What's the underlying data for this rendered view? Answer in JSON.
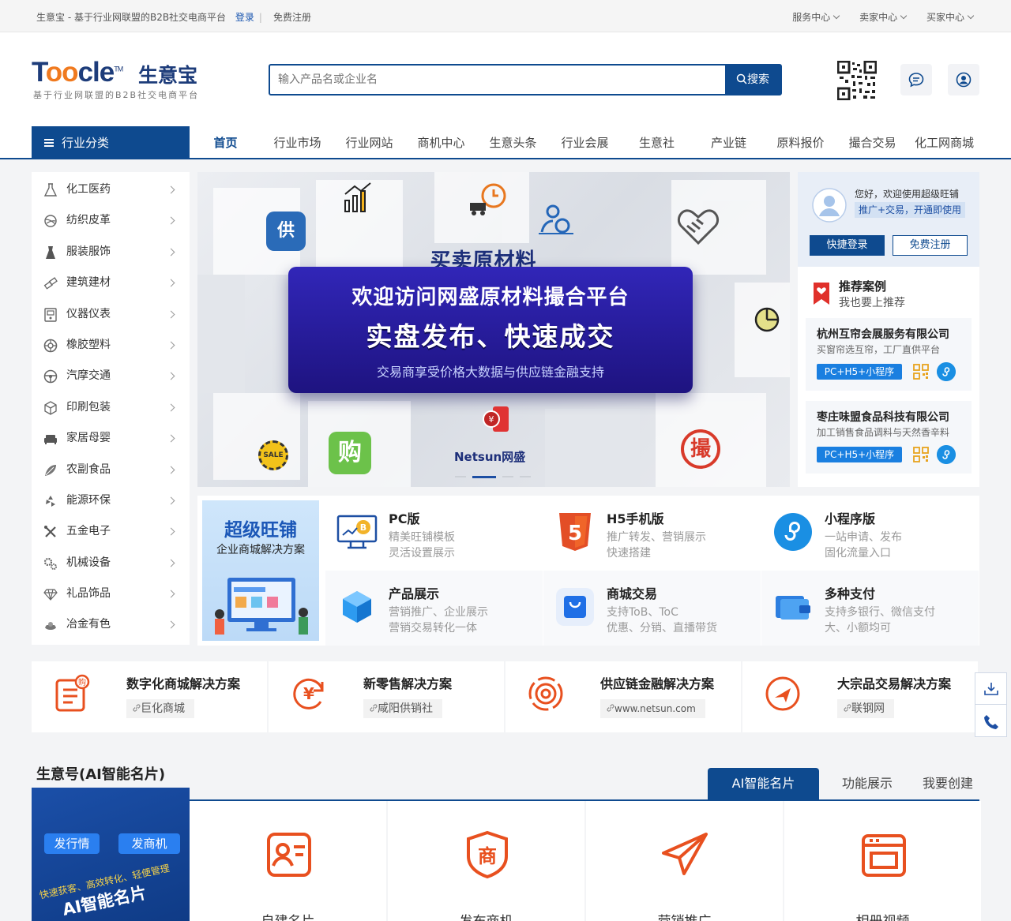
{
  "topbar": {
    "site_desc": "生意宝 - 基于行业网联盟的B2B社交电商平台",
    "login": "登录",
    "register": "免费注册",
    "links": [
      "服务中心",
      "卖家中心",
      "买家中心"
    ]
  },
  "logo": {
    "brand": "Toocle",
    "cn": "生意宝",
    "tagline": "基于行业网联盟的B2B社交电商平台"
  },
  "search": {
    "placeholder": "输入产品名或企业名",
    "button": "搜索"
  },
  "nav": {
    "category_label": "行业分类",
    "items": [
      "首页",
      "行业市场",
      "行业网站",
      "商机中心",
      "生意头条",
      "行业会展",
      "生意社",
      "产业链",
      "原料报价",
      "撮合交易",
      "化工网商城"
    ]
  },
  "categories": [
    "化工医药",
    "纺织皮革",
    "服装服饰",
    "建筑建材",
    "仪器仪表",
    "橡胶塑料",
    "汽摩交通",
    "印刷包装",
    "家居母婴",
    "农副食品",
    "能源环保",
    "五金电子",
    "机械设备",
    "礼品饰品",
    "冶金有色"
  ],
  "banner": {
    "top": "买卖原材料",
    "line1": "欢迎访问网盛原材料撮合平台",
    "line2": "实盘发布、快速成交",
    "line3": "交易商享受价格大数据与供应链金融支持",
    "badge_gong": "供",
    "badge_gou": "购",
    "badge_cuo": "撮",
    "netsun": "Netsun网盛",
    "sale": "SALE"
  },
  "welcome": {
    "greet": "您好，欢迎使用超级旺铺",
    "sub": "推广+交易，开通即使用",
    "login": "快捷登录",
    "register": "免费注册"
  },
  "recommend": {
    "title": "推荐案例",
    "sub": "我也要上推荐",
    "cases": [
      {
        "name": "杭州互帘会展服务有限公司",
        "desc": "买窗帘选互帘，工厂直供平台",
        "tag": "PC+H5+小程序"
      },
      {
        "name": "枣庄味盟食品科技有限公司",
        "desc": "加工销售食品调料与天然香辛料",
        "tag": "PC+H5+小程序"
      }
    ]
  },
  "wangpu": {
    "promo_title": "超级旺铺",
    "promo_sub": "企业商城解决方案",
    "features": [
      {
        "title": "PC版",
        "d1": "精美旺铺模板",
        "d2": "灵活设置展示"
      },
      {
        "title": "H5手机版",
        "d1": "推广转发、营销展示",
        "d2": "快速搭建"
      },
      {
        "title": "小程序版",
        "d1": "一站申请、发布",
        "d2": "固化流量入口"
      },
      {
        "title": "产品展示",
        "d1": "营销推广、企业展示",
        "d2": "营销交易转化一体"
      },
      {
        "title": "商城交易",
        "d1": "支持ToB、ToC",
        "d2": "优惠、分销、直播带货"
      },
      {
        "title": "多种支付",
        "d1": "支持多银行、微信支付",
        "d2": "大、小额均可"
      }
    ]
  },
  "solutions": [
    {
      "title": "数字化商城解决方案",
      "link": "巨化商城"
    },
    {
      "title": "新零售解决方案",
      "link": "咸阳供销社"
    },
    {
      "title": "供应链金融解决方案",
      "link": "www.netsun.com"
    },
    {
      "title": "大宗品交易解决方案",
      "link": "联钢网"
    }
  ],
  "shengyi": {
    "title": "生意号(AI智能名片)",
    "tabs": [
      "AI智能名片",
      "功能展示",
      "我要创建"
    ],
    "ai_tag1": "发行情",
    "ai_tag2": "发商机",
    "ai_slogan": "快速获客、高效转化、轻便管理",
    "ai_big": "AI智能名片",
    "cards": [
      "自建名片",
      "发布商机",
      "营销推广",
      "相册视频"
    ]
  },
  "colors": {
    "primary": "#0e4a8f",
    "accent": "#e8501f"
  }
}
